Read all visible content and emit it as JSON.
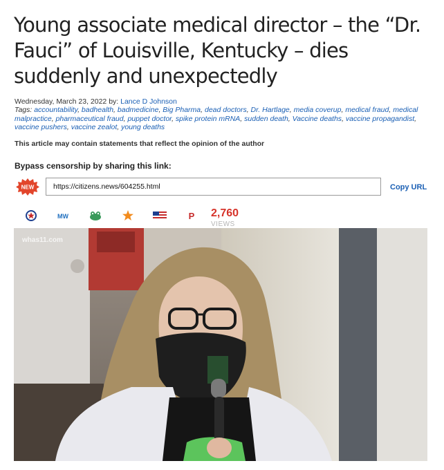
{
  "article": {
    "headline": "Young associate medical director – the “Dr. Fauci” of Louisville, Kentucky – dies suddenly and unexpectedly",
    "date_prefix": "Wednesday, March 23, 2022 by: ",
    "author": "Lance D Johnson",
    "tags_label": "Tags: ",
    "tags": [
      "accountability",
      "badhealth",
      "badmedicine",
      "Big Pharma",
      "dead doctors",
      "Dr. Hartlage",
      "media coverup",
      "medical fraud",
      "medical malpractice",
      "pharmaceutical fraud",
      "puppet doctor",
      "spike protein mRNA",
      "sudden death",
      "Vaccine deaths",
      "vaccine propagandist",
      "vaccine pushers",
      "vaccine zealot",
      "young deaths"
    ],
    "opinion_notice": "This article may contain statements that reflect the opinion of the author"
  },
  "share": {
    "bypass_label": "Bypass censorship by sharing this link:",
    "badge": "NEW",
    "url": "https://citizens.news/604255.html",
    "copy_label": "Copy URL",
    "icons": [
      "star-shield-icon",
      "mw-icon",
      "frog-icon",
      "orange-star-icon",
      "flag-icon",
      "parler-icon"
    ],
    "icon_texts": {
      "mw": "MW",
      "parler": "P"
    },
    "views_count": "2,760",
    "views_label": "VIEWS"
  },
  "photo": {
    "watermark": "whas11.com",
    "description_colors": {
      "coat": "#e9e9ee",
      "hair": "#a88f64",
      "mask": "#1e1e1e",
      "wall": "#d8d4c8"
    }
  }
}
